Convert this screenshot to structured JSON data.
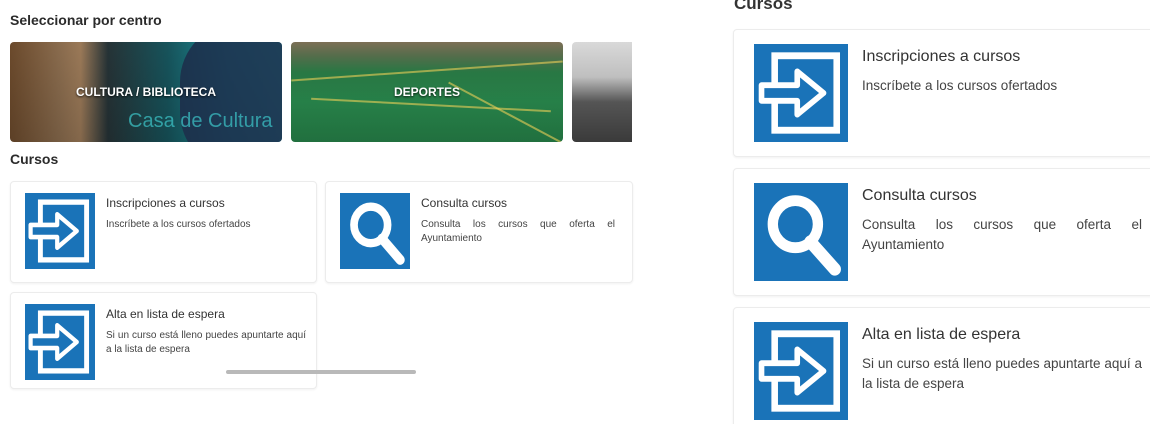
{
  "left": {
    "centers_title": "Seleccionar por centro",
    "centers": [
      {
        "label": "CULTURA / BIBLIOTECA",
        "photo_text": "Casa de Cultura"
      },
      {
        "label": "DEPORTES"
      },
      {
        "label": ""
      }
    ],
    "courses_title": "Cursos",
    "cards": [
      {
        "title": "Inscripciones a cursos",
        "desc": "Inscríbete a los cursos ofertados",
        "icon": "enter-arrow-icon"
      },
      {
        "title": "Consulta cursos",
        "desc": "Consulta los cursos que oferta el Ayuntamiento",
        "icon": "magnifier-icon"
      },
      {
        "title": "Alta en lista de espera",
        "desc": "Si un curso está lleno puedes apuntarte aquí a la lista de espera",
        "icon": "enter-arrow-icon"
      }
    ]
  },
  "right": {
    "courses_title": "Cursos",
    "cards": [
      {
        "title": "Inscripciones a cursos",
        "desc": "Inscríbete a los cursos ofertados",
        "icon": "enter-arrow-icon"
      },
      {
        "title": "Consulta cursos",
        "desc": "Consulta los cursos que oferta el Ayuntamiento",
        "icon": "magnifier-icon"
      },
      {
        "title": "Alta en lista de espera",
        "desc": "Si un curso está lleno puedes apuntarte aquí a la lista de espera",
        "icon": "enter-arrow-icon"
      }
    ]
  },
  "colors": {
    "icon_blue": "#1a73b8",
    "card_border": "#ececec",
    "text": "#333333"
  }
}
